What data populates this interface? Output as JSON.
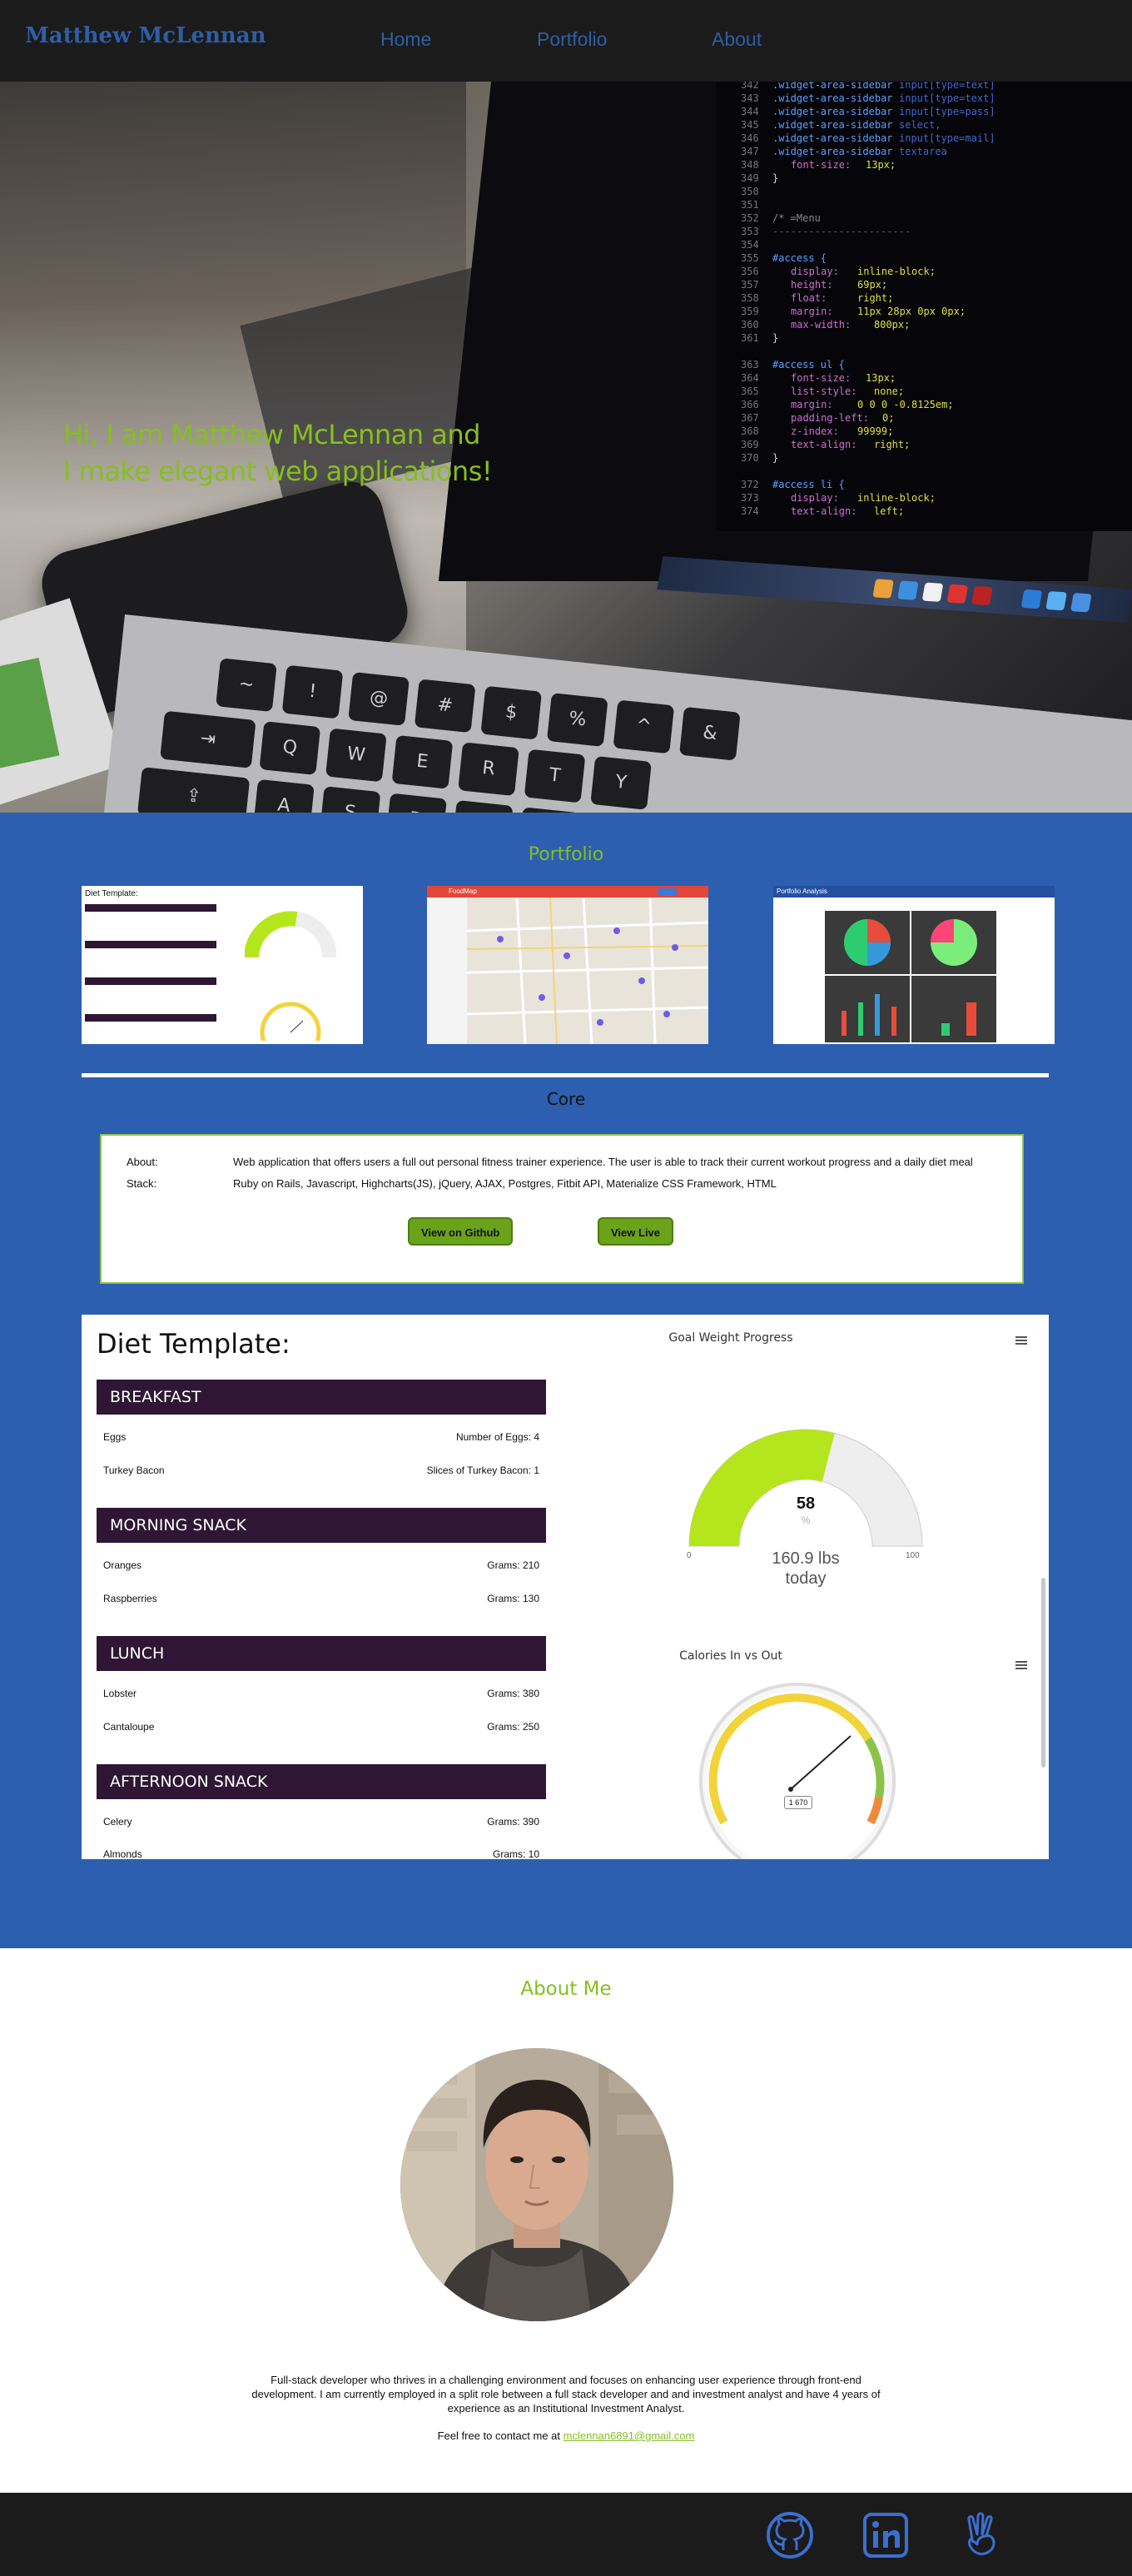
{
  "nav": {
    "brand": "Matthew McLennan",
    "links": [
      "Home",
      "Portfolio",
      "About"
    ]
  },
  "hero": {
    "line1": "Hi, I am Matthew McLennan and",
    "line2": "I make elegant web applications!"
  },
  "portfolio": {
    "title": "Portfolio",
    "thumbnails": [
      {
        "name": "diet-template-thumbnail",
        "header": "Diet Template:"
      },
      {
        "name": "foodmap-thumbnail",
        "header": "FoodMap"
      },
      {
        "name": "portfolio-analysis-thumbnail",
        "header": "Portfolio Analysis"
      }
    ],
    "core_title": "Core",
    "about_label": "About:",
    "about_text": "Web application that offers users a full out personal fitness trainer experience. The user is able to track their current workout progress and a daily diet meal",
    "stack_label": "Stack:",
    "stack_text": "Ruby on Rails, Javascript, Highcharts(JS), jQuery, AJAX, Postgres, Fitbit API, Materialize CSS Framework, HTML",
    "github_button": "View on Github",
    "live_button": "View Live"
  },
  "preview": {
    "title": "Diet Template:",
    "meals": [
      {
        "name": "BREAKFAST",
        "items": [
          {
            "food": "Eggs",
            "amount": "Number of Eggs: 4"
          },
          {
            "food": "Turkey Bacon",
            "amount": "Slices of Turkey Bacon: 1"
          }
        ]
      },
      {
        "name": "MORNING SNACK",
        "items": [
          {
            "food": "Oranges",
            "amount": "Grams: 210"
          },
          {
            "food": "Raspberries",
            "amount": "Grams: 130"
          }
        ]
      },
      {
        "name": "LUNCH",
        "items": [
          {
            "food": "Lobster",
            "amount": "Grams: 380"
          },
          {
            "food": "Cantaloupe",
            "amount": "Grams: 250"
          }
        ]
      },
      {
        "name": "AFTERNOON SNACK",
        "items": [
          {
            "food": "Celery",
            "amount": "Grams: 390"
          },
          {
            "food": "Almonds",
            "amount": "Grams: 10"
          }
        ]
      }
    ],
    "gauge1": {
      "title": "Goal Weight Progress",
      "value": "58",
      "unit": "%",
      "min": "0",
      "max": "100",
      "sub1": "160.9 lbs",
      "sub2": "today",
      "progress_fraction": 0.58,
      "fill_color": "#b5e61d"
    },
    "gauge2": {
      "title": "Calories In vs Out",
      "value": "1 670"
    }
  },
  "about": {
    "title": "About Me",
    "bio": "Full-stack developer who thrives in a challenging environment and focuses on enhancing user experience through front-end development. I am currently employed in a split role between a full stack developer and and investment analyst and have 4 years of experience as an Institutional Investment Analyst.",
    "contact_prefix": "Feel free to contact me at ",
    "email": "mclennan6891@gmail.com"
  },
  "footer": {
    "icons": [
      "github-icon",
      "linkedin-icon",
      "angellist-icon"
    ]
  },
  "colors": {
    "accent_green": "#86bf1e",
    "nav_blue": "#2f5ea6",
    "portfolio_bg": "#2c5faf",
    "meal_bar": "#2f1634",
    "dark": "#1b1b1b"
  }
}
